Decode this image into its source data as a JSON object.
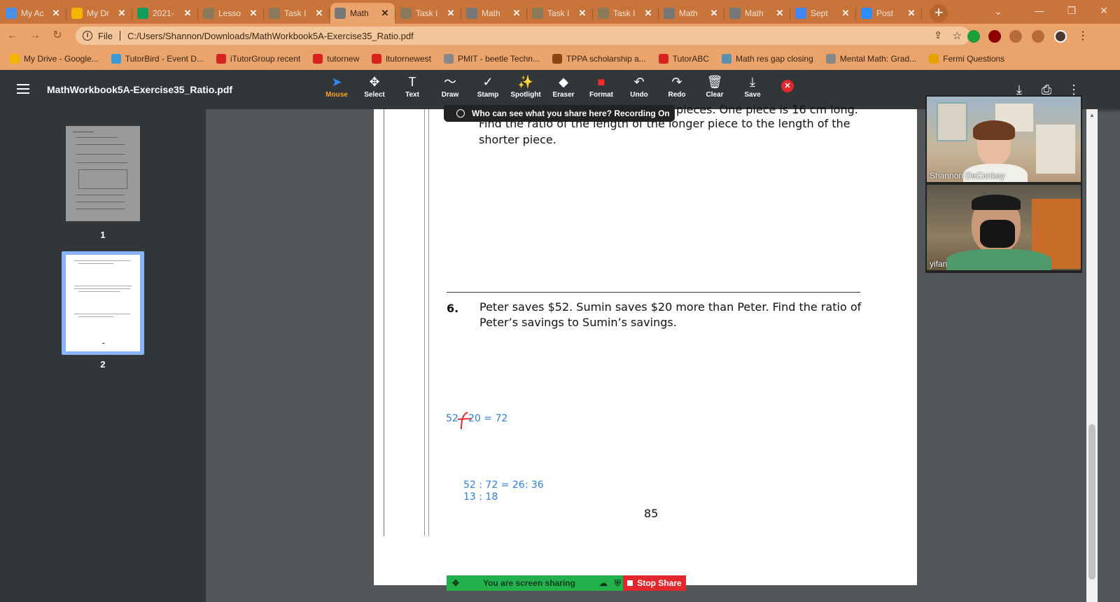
{
  "browser": {
    "tabs": [
      {
        "label": "My Ac",
        "icon": "classroom-icon",
        "color": "#4a8fe7"
      },
      {
        "label": "My Dr",
        "icon": "drive-icon",
        "color": "#f4b400"
      },
      {
        "label": "2021-",
        "icon": "sheets-icon",
        "color": "#0f9d58"
      },
      {
        "label": "Lesso",
        "icon": "doc-icon",
        "color": "#8a7a5a"
      },
      {
        "label": "Task I",
        "icon": "doc-icon",
        "color": "#8a7a5a"
      },
      {
        "label": "Math",
        "icon": "globe-icon",
        "color": "#777777",
        "active": true
      },
      {
        "label": "Task I",
        "icon": "doc-icon",
        "color": "#8a7a5a"
      },
      {
        "label": "Math",
        "icon": "globe-icon",
        "color": "#777777"
      },
      {
        "label": "Task I",
        "icon": "doc-icon",
        "color": "#8a7a5a"
      },
      {
        "label": "Task I",
        "icon": "doc-icon",
        "color": "#8a7a5a"
      },
      {
        "label": "Math",
        "icon": "globe-icon",
        "color": "#777777"
      },
      {
        "label": "Math",
        "icon": "globe-icon",
        "color": "#777777"
      },
      {
        "label": "Sept",
        "icon": "docs-icon",
        "color": "#4285f4"
      },
      {
        "label": "Post",
        "icon": "zoom-icon",
        "color": "#2d8cff"
      }
    ],
    "close_glyph": "✕",
    "new_tab_glyph": "+",
    "omnibox": {
      "scheme": "File",
      "url": "C:/Users/Shannon/Downloads/MathWorkbook5A-Exercise35_Ratio.pdf"
    },
    "bookmarks": [
      {
        "label": "My Drive - Google...",
        "color": "#f4b400"
      },
      {
        "label": "TutorBird - Event D...",
        "color": "#3b9ad9"
      },
      {
        "label": "iTutorGroup recent",
        "color": "#d6231f"
      },
      {
        "label": "tutornew",
        "color": "#d6231f"
      },
      {
        "label": "ltutornewest",
        "color": "#d6231f"
      },
      {
        "label": "PMIT - beetle Techn...",
        "color": "#888888"
      },
      {
        "label": "TPPA scholarship a...",
        "color": "#8b4513"
      },
      {
        "label": "TutorABC",
        "color": "#d6231f"
      },
      {
        "label": "Math res gap closing",
        "color": "#5a8fb0"
      },
      {
        "label": "Mental Math: Grad...",
        "color": "#888888"
      },
      {
        "label": "Fermi Questions",
        "color": "#e6a100"
      }
    ]
  },
  "pdf": {
    "title": "MathWorkbook5A-Exercise35_Ratio.pdf",
    "thumbnails": [
      {
        "number": "1"
      },
      {
        "number": "2"
      }
    ]
  },
  "annotate": {
    "tools": [
      {
        "label": "Mouse",
        "glyph": "➤",
        "selected": true
      },
      {
        "label": "Select",
        "glyph": "✥"
      },
      {
        "label": "Text",
        "glyph": "T"
      },
      {
        "label": "Draw",
        "glyph": "〜"
      },
      {
        "label": "Stamp",
        "glyph": "✓"
      },
      {
        "label": "Spotlight",
        "glyph": "✨"
      },
      {
        "label": "Eraser",
        "glyph": "◆"
      },
      {
        "label": "Format",
        "glyph": "■"
      },
      {
        "label": "Undo",
        "glyph": "↶"
      },
      {
        "label": "Redo",
        "glyph": "↷"
      },
      {
        "label": "Clear",
        "glyph": "🗑"
      },
      {
        "label": "Save",
        "glyph": "⤓"
      }
    ],
    "share_notice": "Who can see what you share here? Recording On"
  },
  "document": {
    "q5_fragment_line1": "pieces. One piece is 16 cm long.",
    "q5_line2": "Find the ratio of the length of the longer piece to the length of the",
    "q5_line3": "shorter piece.",
    "q6_number": "6.",
    "q6_line1": "Peter saves $52. Sumin saves $20 more than Peter. Find the ratio of",
    "q6_line2": "Peter’s savings to Sumin’s savings.",
    "handwriting": {
      "line1_a": "52",
      "line1_b": "20 = 72",
      "line2": "52 : 72 = 26: 36",
      "line3": "13 : 18"
    },
    "page_number": "85"
  },
  "video": {
    "participants": [
      {
        "name": "Shannon DeConkey"
      },
      {
        "name": "yifan"
      }
    ]
  },
  "share_bar": {
    "status": "You are screen sharing",
    "stop": "Stop Share"
  },
  "colors": {
    "chrome_theme": "#c8743a",
    "annotation_blue": "#2f7fd6",
    "annotation_red": "#e0282e",
    "share_green": "#23b14d"
  }
}
